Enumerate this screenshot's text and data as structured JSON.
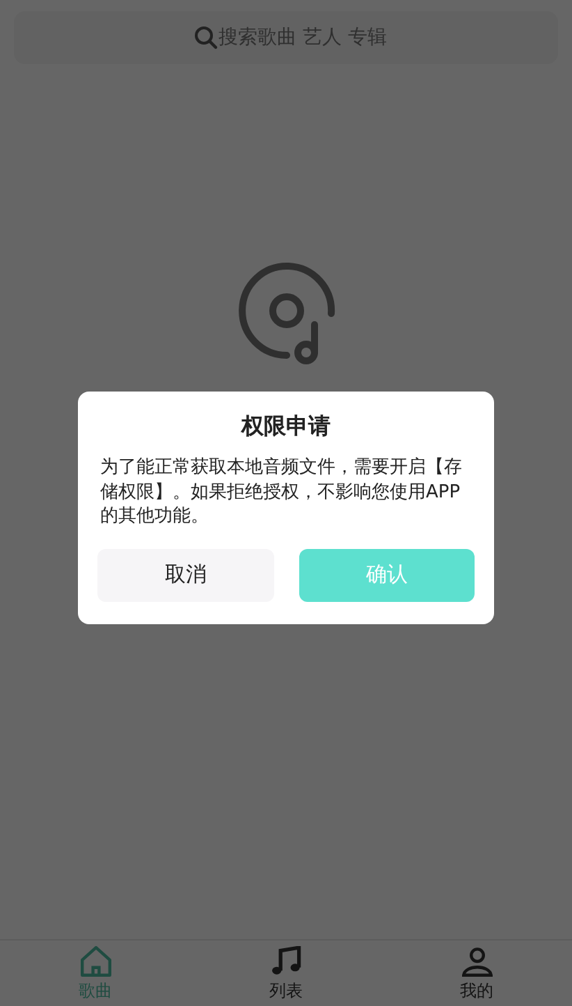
{
  "search": {
    "placeholder": "搜索歌曲 艺人 专辑"
  },
  "dialog": {
    "title": "权限申请",
    "message": "为了能正常获取本地音频文件，需要开启【存储权限】。如果拒绝授权，不影响您使用APP的其他功能。",
    "buttons": [
      {
        "label": "取消",
        "kind": "cancel"
      },
      {
        "label": "确认",
        "kind": "confirm"
      }
    ]
  },
  "tabs": [
    {
      "label": "歌曲",
      "kind": "home",
      "selected": true
    },
    {
      "label": "列表",
      "kind": "music",
      "selected": false
    },
    {
      "label": "我的",
      "kind": "person",
      "selected": false
    }
  ]
}
